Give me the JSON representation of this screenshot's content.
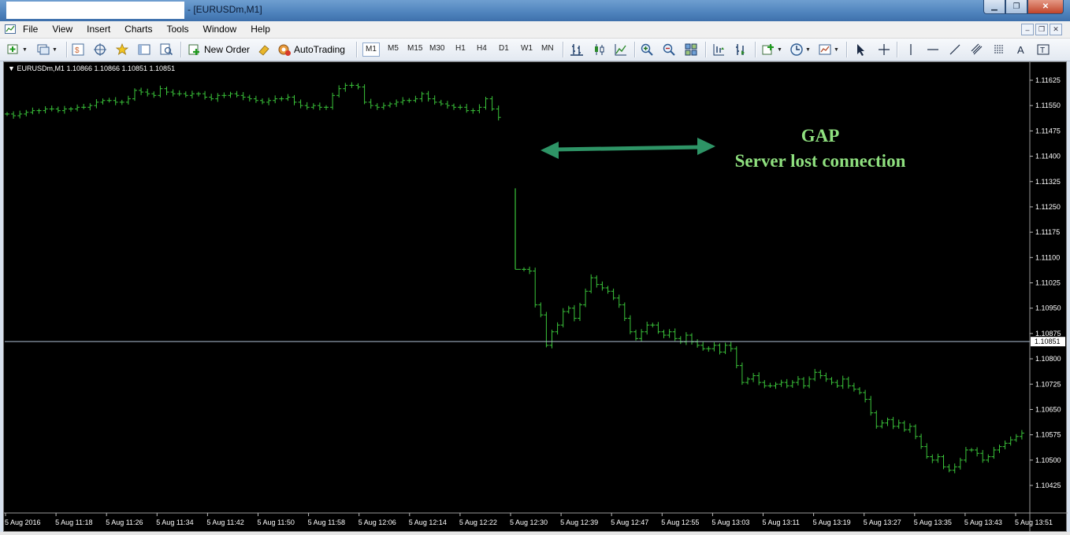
{
  "window": {
    "title": "- [EURUSDm,M1]"
  },
  "menu": [
    "File",
    "View",
    "Insert",
    "Charts",
    "Tools",
    "Window",
    "Help"
  ],
  "toolbar": {
    "new_order": "New Order",
    "autotrading": "AutoTrading",
    "timeframes": [
      "M1",
      "M5",
      "M15",
      "M30",
      "H1",
      "H4",
      "D1",
      "W1",
      "MN"
    ],
    "active_timeframe": "M1"
  },
  "chart": {
    "info": "EURUSDm,M1  1.10866 1.10866 1.10851 1.10851",
    "annotation": {
      "line1": "GAP",
      "line2": "Server lost connection"
    },
    "colors": {
      "background": "#000000",
      "bars": "#3ac43a",
      "bid_line": "#aebfd4",
      "text": "#ffffff",
      "annotation": "#8fe07f",
      "arrow": "#2e9466"
    }
  },
  "chart_data": {
    "type": "bar",
    "symbol": "EURUSDm",
    "timeframe": "M1",
    "current_price": "1.10851",
    "ylim": [
      1.10425,
      1.11625
    ],
    "y_ticks": [
      "1.11625",
      "1.11550",
      "1.11475",
      "1.11400",
      "1.11325",
      "1.11250",
      "1.11175",
      "1.11100",
      "1.11025",
      "1.10950",
      "1.10875",
      "1.10800",
      "1.10725",
      "1.10650",
      "1.10575",
      "1.10500",
      "1.10425"
    ],
    "x_ticks": [
      "5 Aug 2016",
      "5 Aug 11:18",
      "5 Aug 11:26",
      "5 Aug 11:34",
      "5 Aug 11:42",
      "5 Aug 11:50",
      "5 Aug 11:58",
      "5 Aug 12:06",
      "5 Aug 12:14",
      "5 Aug 12:22",
      "5 Aug 12:30",
      "5 Aug 12:39",
      "5 Aug 12:47",
      "5 Aug 12:55",
      "5 Aug 13:03",
      "5 Aug 13:11",
      "5 Aug 13:19",
      "5 Aug 13:27",
      "5 Aug 13:35",
      "5 Aug 13:43",
      "5 Aug 13:51"
    ],
    "series_before_gap": [
      1.11525,
      1.1152,
      1.11525,
      1.1153,
      1.11535,
      1.11535,
      1.1154,
      1.1154,
      1.11535,
      1.1154,
      1.1154,
      1.11545,
      1.11545,
      1.1155,
      1.1156,
      1.11565,
      1.11565,
      1.1156,
      1.1156,
      1.1157,
      1.11595,
      1.1159,
      1.11585,
      1.1158,
      1.116,
      1.1159,
      1.11585,
      1.11585,
      1.1158,
      1.11585,
      1.11585,
      1.11575,
      1.1157,
      1.1158,
      1.1158,
      1.11585,
      1.1158,
      1.11575,
      1.1157,
      1.11565,
      1.1156,
      1.11565,
      1.1157,
      1.1157,
      1.11575,
      1.1156,
      1.1155,
      1.11545,
      1.1155,
      1.11545,
      1.11545,
      1.1158,
      1.116,
      1.1161,
      1.1161,
      1.11605,
      1.1156,
      1.1155,
      1.11545,
      1.1155,
      1.11555,
      1.1156,
      1.11565,
      1.11565,
      1.1157,
      1.11585,
      1.1157,
      1.1156,
      1.11555,
      1.1155,
      1.11545,
      1.11545,
      1.11535,
      1.11535,
      1.11545,
      1.1157,
      1.1154,
      1.11515
    ],
    "series_after_gap": [
      1.11065,
      1.1106,
      1.1096,
      1.1093,
      1.1084,
      1.1088,
      1.109,
      1.1094,
      1.1095,
      1.1092,
      1.1096,
      1.11,
      1.1104,
      1.1102,
      1.1101,
      1.11,
      1.1098,
      1.1096,
      1.1092,
      1.1088,
      1.1086,
      1.1088,
      1.109,
      1.109,
      1.1088,
      1.1087,
      1.1088,
      1.1086,
      1.1085,
      1.1087,
      1.1085,
      1.1084,
      1.1083,
      1.1083,
      1.1084,
      1.1082,
      1.1084,
      1.1083,
      1.1078,
      1.1073,
      1.1074,
      1.1075,
      1.1073,
      1.1072,
      1.1072,
      1.10725,
      1.1073,
      1.1072,
      1.1073,
      1.1074,
      1.1072,
      1.1074,
      1.1076,
      1.1075,
      1.1074,
      1.1073,
      1.1072,
      1.1074,
      1.1072,
      1.1071,
      1.107,
      1.1068,
      1.1064,
      1.106,
      1.1061,
      1.1062,
      1.106,
      1.1061,
      1.1059,
      1.106,
      1.1057,
      1.1054,
      1.1051,
      1.105,
      1.1051,
      1.1048,
      1.1047,
      1.1048,
      1.105,
      1.1053,
      1.1053,
      1.1052,
      1.105,
      1.1051,
      1.1053,
      1.1054,
      1.1055,
      1.1056,
      1.1057,
      1.1058
    ]
  }
}
